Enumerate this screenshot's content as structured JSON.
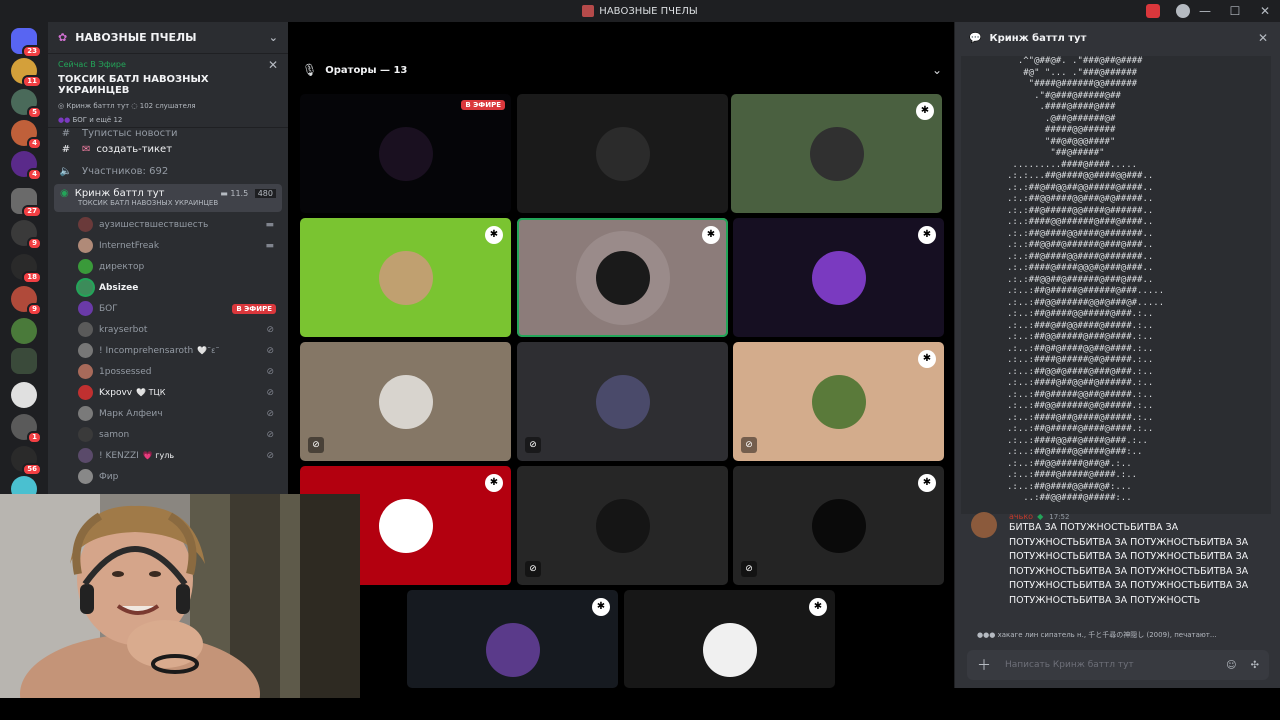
{
  "window": {
    "title": "НАВОЗНЫЕ ПЧЕЛЫ",
    "controls": [
      "—",
      "☐",
      "✕"
    ]
  },
  "rail": {
    "badges": [
      "23",
      "11",
      "5",
      "4",
      "4",
      "27",
      "9",
      "18",
      "9",
      "1",
      "56"
    ]
  },
  "server": {
    "name": "НАВОЗНЫЕ ПЧЕЛЫ",
    "live_now": "Сейчас В Эфире",
    "live_title": "ТОКСИК БАТЛ НАВОЗНЫХ УКРАИНЦЕВ",
    "live_channel": "Кринж баттл тут",
    "live_listeners": "102 слушателя",
    "live_with": "БОГ и ещё 12"
  },
  "channels": {
    "partial": "Тупистыс новости",
    "ticket": "создать-тикет",
    "members": "Участников: 692",
    "voice_name": "Кринж баттл тут",
    "voice_sub": "ТОКСИК БАТЛ НАВОЗНЫХ УКРАИНЦЕВ",
    "voice_count_left": "11.5",
    "voice_count_right": "480"
  },
  "members": [
    {
      "name": "аузишествшествшесть",
      "color": "#6a3a3a"
    },
    {
      "name": "InternetFreak",
      "color": "#b08a78"
    },
    {
      "name": "директор",
      "color": "#3a9a3a"
    },
    {
      "name": "Absizee",
      "color": "#3c8c5a"
    },
    {
      "name": "БОГ",
      "color": "#6a3aa8"
    },
    {
      "name": "krayserbot",
      "color": "#5a5a5a"
    },
    {
      "name": "! Incomprehensaroth",
      "color": "#777"
    },
    {
      "name": "1possessed",
      "color": "#a86a5a"
    },
    {
      "name": "Kxpovv",
      "color": "#c03030"
    },
    {
      "name": "Марк Алфеич",
      "color": "#7a7a7a"
    },
    {
      "name": "samon",
      "color": "#3a3a3a"
    },
    {
      "name": "! KENZZI",
      "color": "#5a4a6a"
    },
    {
      "name": "Фир",
      "color": "#888"
    }
  ],
  "member_tags": {
    "incomp": "🤍˜ε˜",
    "kxpovv": "🤍 ТЦК",
    "kenzzi": "💗 гуль"
  },
  "live_tag": "В ЭФИРЕ",
  "stage": {
    "header": "Ораторы — 13",
    "tiles": [
      {
        "bg": "#050508",
        "av": "#1a1020"
      },
      {
        "bg": "#1a1a1a",
        "av": "#2b2b2b"
      },
      {
        "bg": "#4a6040",
        "av": "#303030"
      },
      {
        "bg": "#7ac431",
        "av": "#c0a070"
      },
      {
        "bg": "#8c7c7a",
        "av": "#1a1a1a"
      },
      {
        "bg": "#160f22",
        "av": "#7a3ac0"
      },
      {
        "bg": "#857766",
        "av": "#d8d4ce"
      },
      {
        "bg": "#2e2e32",
        "av": "#4a4a6a"
      },
      {
        "bg": "#d3ac8c",
        "av": "#5a7a3a"
      },
      {
        "bg": "#b3000f",
        "av": "#ffffff"
      },
      {
        "bg": "#262626",
        "av": "#151515"
      },
      {
        "bg": "#242424",
        "av": "#0a0a0a"
      },
      {
        "bg": "#161a20",
        "av": "#5a3a8a"
      },
      {
        "bg": "#171717",
        "av": "#f0f0f0"
      }
    ]
  },
  "chat": {
    "title": "Кринж баттл тут",
    "username": "ачько",
    "time": "17:52",
    "message": "БИТВА ЗА ПОТУЖНОСТЬБИТВА ЗА ПОТУЖНОСТЬБИТВА ЗА ПОТУЖНОСТЬБИТВА ЗА ПОТУЖНОСТЬБИТВА ЗА ПОТУЖНОСТЬБИТВА ЗА ПОТУЖНОСТЬБИТВА ЗА ПОТУЖНОСТЬБИТВА ЗА ПОТУЖНОСТЬБИТВА ЗА ПОТУЖНОСТЬБИТВА ЗА ПОТУЖНОСТЬБИТВА ЗА ПОТУЖНОСТЬ",
    "typing": "хакаге лин сипатель н., 千と千尋の神隠し (2009), печатают...",
    "placeholder": "Написать Кринж баттл тут",
    "ascii": "  .^\"@##@#. .\"###@##@####\n   #@\" \"... .\"###@######\n    \"####@######@@######\n     .\"#@###@#####@##\n      .####@####@###\n       .@##@######@#\n       #####@@######\n       \"##@#@@@####\"\n        \"##@#####\"\n .........####@####.....\n.:.:...##@####@@####@@###..\n.:.:##@##@@##@@#####@####..\n.:.:##@@####@@###@#@#####..\n.:.:##@#####@@####@######..\n.:.:####@@######@###@####..\n.:.:##@####@@####@#######..\n.:.:##@@##@######@###@###..\n.:.:##@####@@####@#######..\n.:.:####@####@@@#@###@###..\n.:.:##@@##@######@###@###..\n.:..:##@#####@######@###.....\n.:..:##@@######@@#@###@#.....\n.:..:##@####@@#####@###.:..\n.:..:###@##@@####@#####.:..\n.:..:##@@#####@###@####.:..\n.:..:##@#@####@@##@####.:..\n.:..:####@#####@#@#####.:..\n.:..:##@@#@####@###@###.:..\n.:..:####@##@@##@######.:..\n.:..:##@#####@@##@#####.:..\n.:..:##@@######@#@#####.:..\n.:..:####@##@####@#####.:..\n.:..:##@#####@####@####.:..\n.:..:####@@##@####@###.:..\n.:..:##@####@@####@###:..\n.:..:##@@#####@##@#.:..\n.:..:####@#####@####.:..\n.:..:##@####@@###@#:...\n   ..:##@@####@#####:.."
  }
}
